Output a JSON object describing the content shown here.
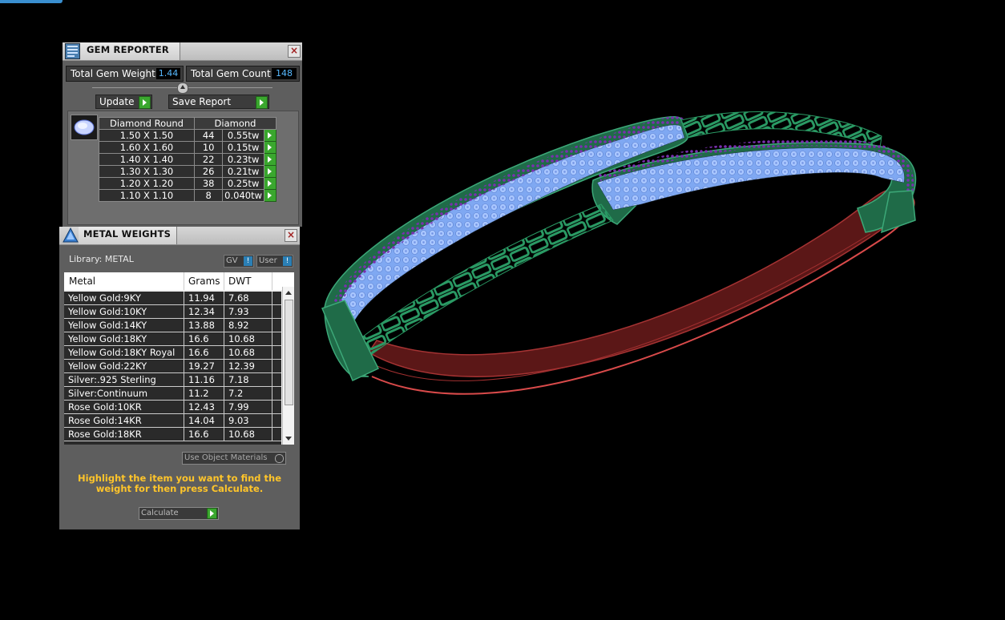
{
  "gem_reporter": {
    "title": "GEM REPORTER",
    "close": "×",
    "total_weight_label": "Total Gem Weight",
    "total_weight_value": "1.44",
    "total_count_label": "Total Gem Count",
    "total_count_value": "148",
    "update_label": "Update",
    "save_label": "Save Report",
    "table": {
      "header_shape": "Diamond Round",
      "header_material": "Diamond",
      "rows": [
        {
          "size": "1.50 X 1.50",
          "count": "44",
          "weight": "0.55tw"
        },
        {
          "size": "1.60 X 1.60",
          "count": "10",
          "weight": "0.15tw"
        },
        {
          "size": "1.40 X 1.40",
          "count": "22",
          "weight": "0.23tw"
        },
        {
          "size": "1.30 X 1.30",
          "count": "26",
          "weight": "0.21tw"
        },
        {
          "size": "1.20 X 1.20",
          "count": "38",
          "weight": "0.25tw"
        },
        {
          "size": "1.10 X 1.10",
          "count": "8",
          "weight": "0.040tw"
        }
      ]
    }
  },
  "metal_weights": {
    "title": "METAL WEIGHTS",
    "close": "×",
    "library_label": "Library: METAL",
    "gv_label": "GV",
    "user_label": "User",
    "toggle_glyph": "!",
    "columns": {
      "metal": "Metal",
      "grams": "Grams",
      "dwt": "DWT"
    },
    "rows": [
      {
        "metal": "Yellow Gold:9KY",
        "grams": "11.94",
        "dwt": "7.68"
      },
      {
        "metal": "Yellow Gold:10KY",
        "grams": "12.34",
        "dwt": "7.93"
      },
      {
        "metal": "Yellow Gold:14KY",
        "grams": "13.88",
        "dwt": "8.92"
      },
      {
        "metal": "Yellow Gold:18KY",
        "grams": "16.6",
        "dwt": "10.68"
      },
      {
        "metal": "Yellow Gold:18KY Royal",
        "grams": "16.6",
        "dwt": "10.68"
      },
      {
        "metal": "Yellow Gold:22KY",
        "grams": "19.27",
        "dwt": "12.39"
      },
      {
        "metal": "Silver:.925 Sterling",
        "grams": "11.16",
        "dwt": "7.18"
      },
      {
        "metal": "Silver:Continuum",
        "grams": "11.2",
        "dwt": "7.2"
      },
      {
        "metal": "Rose Gold:10KR",
        "grams": "12.43",
        "dwt": "7.99"
      },
      {
        "metal": "Rose Gold:14KR",
        "grams": "14.04",
        "dwt": "9.03"
      },
      {
        "metal": "Rose Gold:18KR",
        "grams": "16.6",
        "dwt": "10.68"
      }
    ],
    "use_object_label": "Use Object Materials",
    "hint": "Highlight the item you want to find the weight for then press Calculate.",
    "calculate_label": "Calculate"
  },
  "viewport": {
    "model": "bangle-bracelet-3d-model",
    "colors": {
      "setting": "#1f7a52",
      "stones": "#7fa8f2",
      "prongs": "#7a2fb0",
      "band": "#b83434"
    }
  }
}
